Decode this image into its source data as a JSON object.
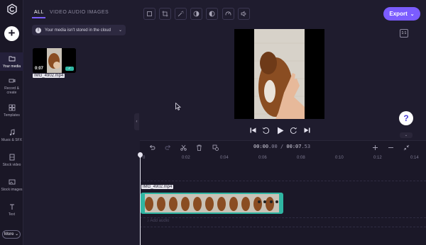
{
  "rail": {
    "items": [
      {
        "label": "Your media",
        "icon": "folder-icon"
      },
      {
        "label": "Record & create",
        "icon": "camera-icon"
      },
      {
        "label": "Templates",
        "icon": "grid-icon"
      },
      {
        "label": "Music & SFX",
        "icon": "music-icon"
      },
      {
        "label": "Stock video",
        "icon": "film-icon"
      },
      {
        "label": "Stock images",
        "icon": "image-icon"
      },
      {
        "label": "Text",
        "icon": "text-icon"
      }
    ],
    "more_label": "More"
  },
  "media": {
    "tabs": [
      "ALL",
      "VIDEO",
      "AUDIO",
      "IMAGES"
    ],
    "active_tab": "ALL",
    "notice": "Your media isn't stored in the cloud",
    "item": {
      "duration": "0:07",
      "filename": "IMG_4902.mp4"
    }
  },
  "toolbar": {
    "tools": [
      "crop-icon",
      "resize-icon",
      "magic-icon",
      "contrast-icon",
      "filter-icon",
      "speed-icon",
      "volume-icon"
    ],
    "export_label": "Export",
    "ratio_label": "1:1"
  },
  "preview": {
    "help_label": "?"
  },
  "timeline": {
    "current_time": "00:00",
    "current_frac": ".00",
    "total_time": "00:07",
    "total_frac": ".53",
    "ruler": [
      "0",
      "0:02",
      "0:04",
      "0:06",
      "0:08",
      "0:10",
      "0:12",
      "0:14"
    ],
    "clip_name": "IMG_4902.mp4",
    "add_audio_label": "Add audio"
  },
  "colors": {
    "accent": "#7b5cff",
    "clip_border": "#2fb6a3",
    "background": "#1f1c2e"
  }
}
